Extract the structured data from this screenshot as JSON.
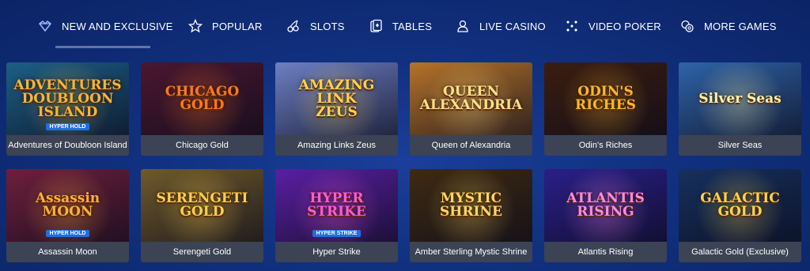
{
  "nav": [
    {
      "label": "NEW AND EXCLUSIVE",
      "icon": "diamond-crown-icon"
    },
    {
      "label": "POPULAR",
      "icon": "star-icon"
    },
    {
      "label": "SLOTS",
      "icon": "cherries-icon"
    },
    {
      "label": "TABLES",
      "icon": "cards-icon"
    },
    {
      "label": "LIVE CASINO",
      "icon": "dealer-icon"
    },
    {
      "label": "VIDEO POKER",
      "icon": "dice-icon"
    },
    {
      "label": "MORE GAMES",
      "icon": "chips-icon"
    }
  ],
  "games": [
    {
      "caption": "Adventures of Doubloon Island",
      "thumb_title": "ADVENTURES\nDOUBLOON\nISLAND",
      "badge": "HYPER HOLD",
      "bg": "#1c5f86",
      "accent": "#f3b63a"
    },
    {
      "caption": "Chicago Gold",
      "thumb_title": "CHICAGO\nGOLD",
      "bg": "#4a1730",
      "accent": "#ff7a1a"
    },
    {
      "caption": "Amazing Links Zeus",
      "thumb_title": "AMAZING\nLINK\nZEUS",
      "bg": "#6d7fc4",
      "accent": "#ffd34d"
    },
    {
      "caption": "Queen of Alexandria",
      "thumb_title": "QUEEN\nALEXANDRIA",
      "bg": "#b5732a",
      "accent": "#ffe08a"
    },
    {
      "caption": "Odin's Riches",
      "thumb_title": "ODIN'S\nRICHES",
      "bg": "#3b1d10",
      "accent": "#ffb62b"
    },
    {
      "caption": "Silver Seas",
      "thumb_title": "Silver Seas",
      "bg": "#2f63a8",
      "accent": "#fff2a8"
    },
    {
      "caption": "Assassin Moon",
      "thumb_title": "Assassin\nMOON",
      "badge": "HYPER HOLD",
      "bg": "#6e1f3c",
      "accent": "#ffb03a"
    },
    {
      "caption": "Serengeti Gold",
      "thumb_title": "SERENGETI\nGOLD",
      "bg": "#6f5a2c",
      "accent": "#ffcf4a"
    },
    {
      "caption": "Hyper Strike",
      "thumb_title": "HYPER\nSTRIKE",
      "badge": "HYPER STRIKE",
      "bg": "#5a1fa3",
      "accent": "#ff5cd0"
    },
    {
      "caption": "Amber Sterling Mystic Shrine",
      "thumb_title": "MYSTIC\nSHRINE",
      "bg": "#3e2a12",
      "accent": "#ffd760"
    },
    {
      "caption": "Atlantis Rising",
      "thumb_title": "ATLANTIS\nRISING",
      "bg": "#2a1f8a",
      "accent": "#ff8ae0"
    },
    {
      "caption": "Galactic Gold (Exclusive)",
      "thumb_title": "GALACTIC\nGOLD",
      "bg": "#16305e",
      "accent": "#ffd34d"
    }
  ]
}
